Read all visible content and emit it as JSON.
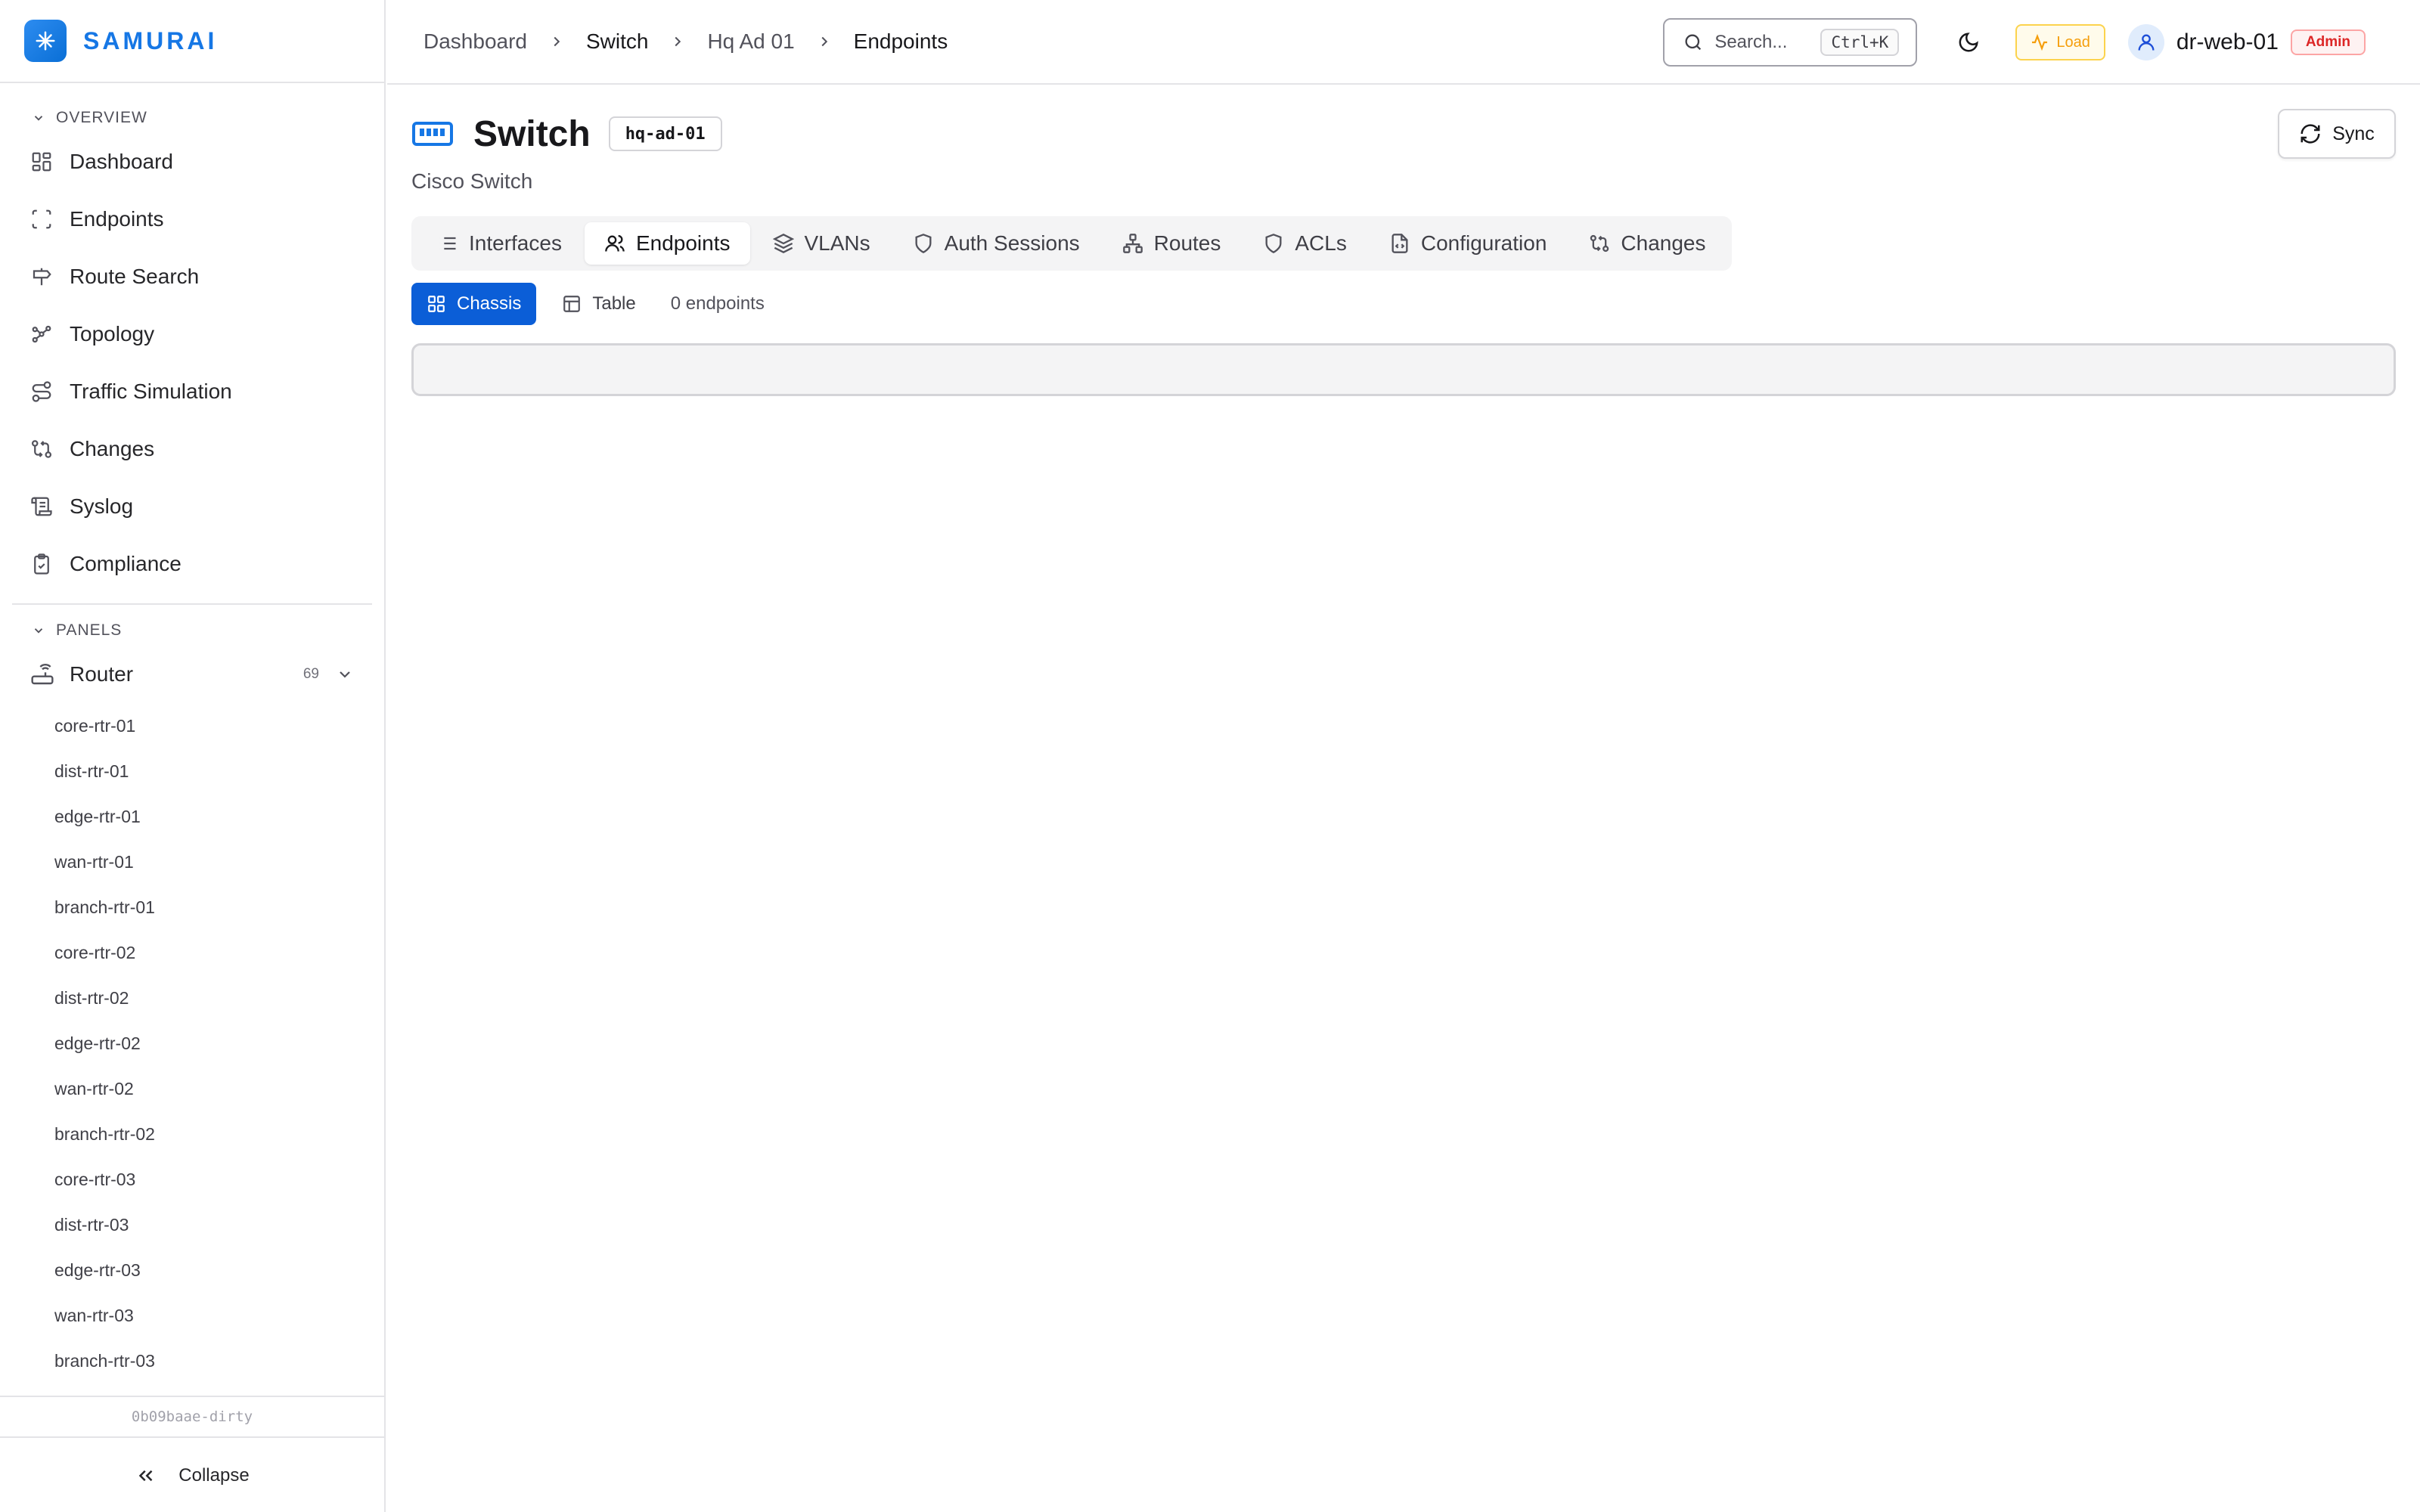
{
  "brand": {
    "name": "SAMURAI"
  },
  "sidebar": {
    "overview_label": "OVERVIEW",
    "nav": [
      {
        "label": "Dashboard",
        "icon": "grid-icon"
      },
      {
        "label": "Endpoints",
        "icon": "scan-icon"
      },
      {
        "label": "Route Search",
        "icon": "signpost-icon"
      },
      {
        "label": "Topology",
        "icon": "topology-icon"
      },
      {
        "label": "Traffic Simulation",
        "icon": "route-icon"
      },
      {
        "label": "Changes",
        "icon": "git-compare-icon"
      },
      {
        "label": "Syslog",
        "icon": "scroll-icon"
      },
      {
        "label": "Compliance",
        "icon": "clipboard-check-icon"
      }
    ],
    "panels_label": "PANELS",
    "panel_group": {
      "label": "Router",
      "count": "69"
    },
    "routers": [
      "core-rtr-01",
      "dist-rtr-01",
      "edge-rtr-01",
      "wan-rtr-01",
      "branch-rtr-01",
      "core-rtr-02",
      "dist-rtr-02",
      "edge-rtr-02",
      "wan-rtr-02",
      "branch-rtr-02",
      "core-rtr-03",
      "dist-rtr-03",
      "edge-rtr-03",
      "wan-rtr-03",
      "branch-rtr-03"
    ],
    "version": "0b09baae-dirty",
    "collapse_label": "Collapse"
  },
  "breadcrumb": [
    "Dashboard",
    "Switch",
    "Hq Ad 01",
    "Endpoints"
  ],
  "topbar": {
    "search_placeholder": "Search...",
    "search_shortcut": "Ctrl+K",
    "load_label": "Load",
    "username": "dr-web-01",
    "role": "Admin"
  },
  "page": {
    "title": "Switch",
    "device_id": "hq-ad-01",
    "subtitle": "Cisco Switch",
    "sync_label": "Sync",
    "tabs": [
      "Interfaces",
      "Endpoints",
      "VLANs",
      "Auth Sessions",
      "Routes",
      "ACLs",
      "Configuration",
      "Changes"
    ],
    "active_tab": "Endpoints",
    "views": [
      "Chassis",
      "Table"
    ],
    "active_view": "Chassis",
    "endpoint_count": "0 endpoints"
  },
  "colors": {
    "brand": "#1677e5",
    "primary_button": "#0b5ed7",
    "load_badge": "#f59e0b",
    "admin_badge": "#dc2626"
  }
}
